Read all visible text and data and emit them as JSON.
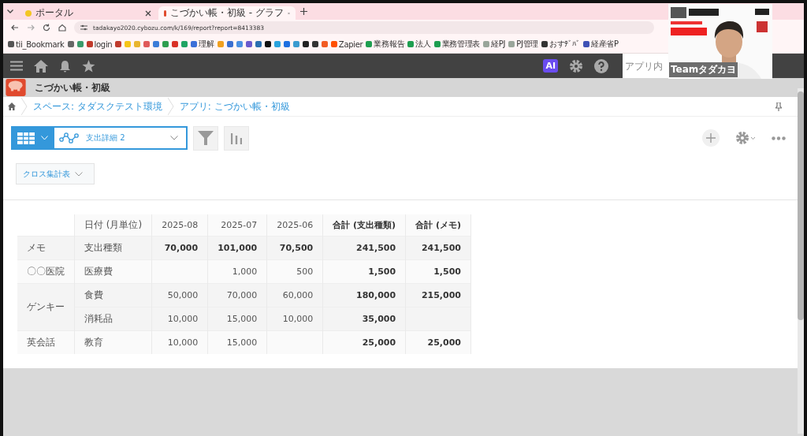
{
  "browser": {
    "tabs": [
      {
        "title": "ポータル",
        "selected": false
      },
      {
        "title": "こづかい帳・初級 - グラフ",
        "selected": true
      }
    ],
    "url": "tadakayo2020.cybozu.com/k/169/report?report=8413383",
    "bookmarks": [
      {
        "label": "tii_Bookmark",
        "color": "#555555"
      },
      {
        "color": "#666666"
      },
      {
        "color": "#3a9a6a"
      },
      {
        "label": "login",
        "color": "#c0392b"
      },
      {
        "color": "#c0392b"
      },
      {
        "color": "#f5c518"
      },
      {
        "color": "#e8b530"
      },
      {
        "color": "#e05a5a"
      },
      {
        "color": "#3b7dd8"
      },
      {
        "color": "#2e9e4f"
      },
      {
        "color": "#d93025"
      },
      {
        "color": "#1fa463"
      },
      {
        "label": "理解",
        "color": "#3b6fd8"
      },
      {
        "color": "#f0a020"
      },
      {
        "color": "#3a6fd0"
      },
      {
        "color": "#4a90e2"
      },
      {
        "color": "#6a5acd"
      },
      {
        "color": "#2a6fb0"
      },
      {
        "color": "#111111"
      },
      {
        "color": "#2aa3dd"
      },
      {
        "color": "#1e6fe0"
      },
      {
        "color": "#3a9bd0"
      },
      {
        "color": "#222222"
      },
      {
        "color": "#333333"
      },
      {
        "color": "#f25a22"
      },
      {
        "label": "Zapier",
        "color": "#ff4f00"
      },
      {
        "label": "業務報告",
        "color": "#1e9e50"
      },
      {
        "label": "法人",
        "color": "#1e9e50"
      },
      {
        "label": "業務管理表",
        "color": "#1e9e50"
      },
      {
        "label": "経PJ",
        "color": "#9aa59a"
      },
      {
        "label": "PJ管理",
        "color": "#9aa59a"
      },
      {
        "label": "おすﾃﾞﾊﾞ",
        "color": "#333333"
      },
      {
        "label": "経産省P",
        "color": "#3f51b5"
      }
    ]
  },
  "header": {
    "ai_badge": "AI",
    "search": {
      "placeholder": "アプリ内"
    }
  },
  "app": {
    "title": "こづかい帳・初級",
    "breadcrumb": [
      "スペース: タダスクテスト環境",
      "アプリ: こづかい帳・初級"
    ]
  },
  "toolbar": {
    "graph_view": "支出詳細 2",
    "cross_table_button": "クロス集計表"
  },
  "table": {
    "columns": [
      "",
      "日付 (月単位)",
      "2025-08",
      "2025-07",
      "2025-06",
      "合計 (支出種類)",
      "合計 (メモ)"
    ],
    "groups": [
      {
        "label": "メモ",
        "kind": "grand_total",
        "rows": [
          {
            "category": "支出種類",
            "values": {
              "month_1": "70,000",
              "month_2": "101,000",
              "month_3": "70,500"
            },
            "total": "241,500",
            "memo_total": "241,500"
          }
        ]
      },
      {
        "label": "〇〇医院",
        "kind": "detail",
        "rows": [
          {
            "category": "医療費",
            "values": {
              "month_2": "1,000",
              "month_3": "500"
            },
            "total": "1,500",
            "memo_total": "1,500"
          }
        ]
      },
      {
        "label": "ゲンキー",
        "kind": "detail",
        "rows": [
          {
            "category": "食費",
            "values": {
              "month_1": "50,000",
              "month_2": "70,000",
              "month_3": "60,000"
            },
            "total": "180,000",
            "memo_total": "215,000"
          },
          {
            "category": "消耗品",
            "values": {
              "month_1": "10,000",
              "month_2": "15,000",
              "month_3": "10,000"
            },
            "total": "35,000"
          }
        ]
      },
      {
        "label": "英会話",
        "kind": "detail",
        "rows": [
          {
            "category": "教育",
            "values": {
              "month_1": "10,000",
              "month_2": "15,000"
            },
            "total": "25,000",
            "memo_total": "25,000"
          }
        ]
      }
    ]
  },
  "webcam": {
    "kind": "picture",
    "name_tag": "Teamタダカヨ"
  }
}
